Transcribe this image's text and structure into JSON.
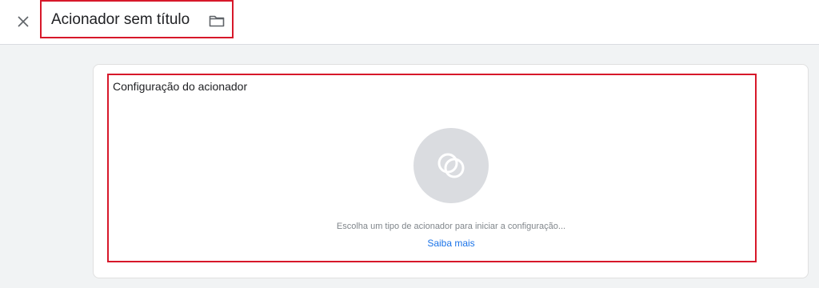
{
  "header": {
    "close_icon": "close-icon",
    "title": "Acionador sem título",
    "folder_icon": "folder-icon"
  },
  "trigger_config": {
    "section_title": "Configuração do acionador",
    "placeholder_icon": "trigger-type-icon",
    "hint": "Escolha um tipo de acionador para iniciar a configuração...",
    "learn_more": "Saiba mais"
  },
  "colors": {
    "highlight_border": "#d7182a",
    "link": "#1a73e8",
    "page_background": "#f1f3f4",
    "icon_circle": "#dadce0"
  }
}
